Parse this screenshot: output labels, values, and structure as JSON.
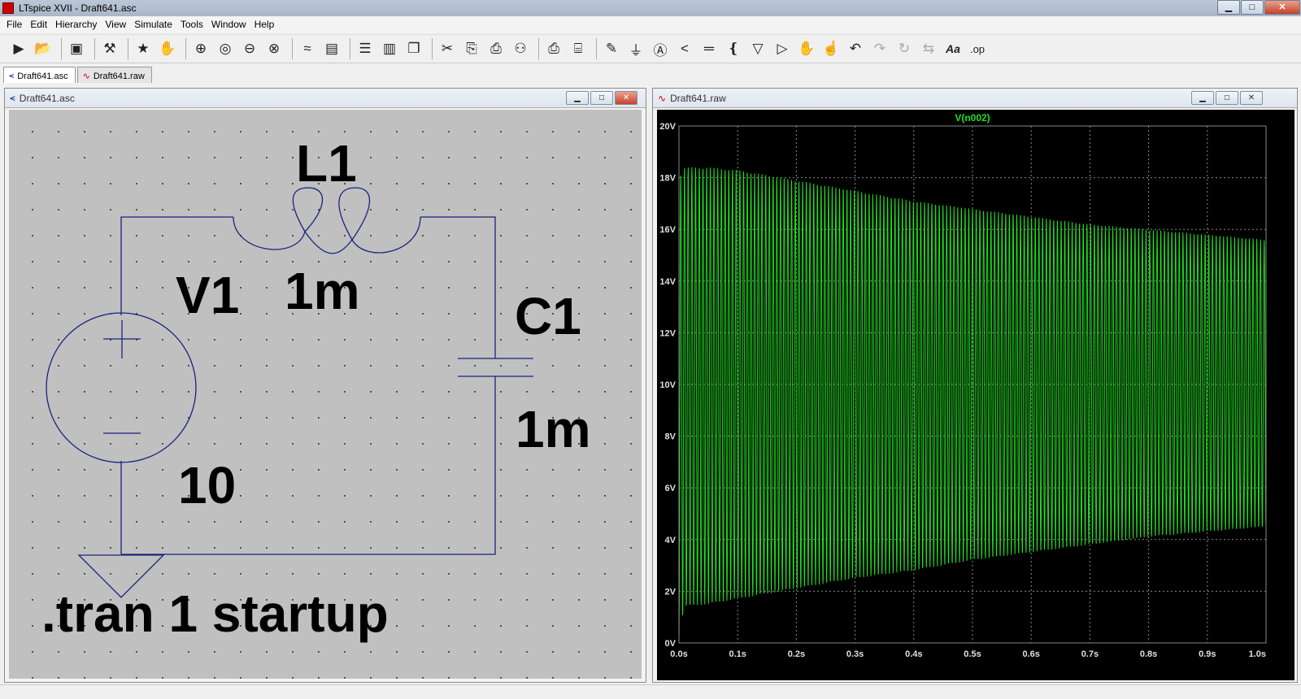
{
  "window": {
    "title": "LTspice XVII - Draft641.asc"
  },
  "menu": [
    "File",
    "Edit",
    "Hierarchy",
    "View",
    "Simulate",
    "Tools",
    "Window",
    "Help"
  ],
  "toolbar": {
    "icons": [
      "run-icon",
      "open-icon",
      "save-icon",
      "control-panel-icon",
      "run-man-icon",
      "pan-hand-icon",
      "zoom-in-icon",
      "zoom-to-fit-icon",
      "zoom-out-icon",
      "zoom-cancel-icon",
      "autorange-icon",
      "plot-settings-icon",
      "tile-horizontal-icon",
      "tile-vertical-icon",
      "cascade-icon",
      "cut-icon",
      "copy-icon",
      "paste-icon",
      "find-icon",
      "print-icon",
      "print-setup-icon",
      "pencil-wire-icon",
      "ground-icon",
      "label-net-icon",
      "resistor-icon",
      "capacitor-icon",
      "inductor-icon",
      "diode-icon",
      "component-icon",
      "move-icon",
      "drag-icon",
      "undo-icon",
      "redo-icon",
      "rotate-icon",
      "mirror-icon",
      "text-icon",
      "spice-directive-icon"
    ],
    "text_buttons": {
      "text": "Aa",
      "op": ".op"
    }
  },
  "tabs": [
    {
      "label": "Draft641.asc"
    },
    {
      "label": "Draft641.raw"
    }
  ],
  "schematic": {
    "title": "Draft641.asc",
    "labels": {
      "l1_name": "L1",
      "l1_value": "1m",
      "v1_name": "V1",
      "v1_value": "10",
      "c1_name": "C1",
      "c1_value": "1m",
      "directive": ".tran 1 startup"
    },
    "colors": {
      "wire": "#1a237e",
      "background": "#c0c0c0",
      "text": "#000000"
    }
  },
  "waveform": {
    "title": "Draft641.raw",
    "trace_label": "V(n002)",
    "colors": {
      "trace": "#22dd22",
      "background": "#000000",
      "grid": "#888888",
      "axis_text": "#e0e0e0"
    }
  },
  "chart_data": {
    "type": "line",
    "title": "V(n002)",
    "xlabel": "",
    "ylabel": "",
    "xlim": [
      0,
      1.0
    ],
    "ylim": [
      0,
      20
    ],
    "x_ticks": [
      "0.0s",
      "0.1s",
      "0.2s",
      "0.3s",
      "0.4s",
      "0.5s",
      "0.6s",
      "0.7s",
      "0.8s",
      "0.9s",
      "1.0s"
    ],
    "y_ticks": [
      "0V",
      "2V",
      "4V",
      "6V",
      "8V",
      "10V",
      "12V",
      "14V",
      "16V",
      "18V",
      "20V"
    ],
    "grid": true,
    "series": [
      {
        "name": "V(n002)",
        "oscillation_frequency_hz": 159,
        "envelope_time_s": [
          0.0,
          0.01,
          0.05,
          0.1,
          0.2,
          0.3,
          0.4,
          0.5,
          0.6,
          0.7,
          0.8,
          0.9,
          1.0
        ],
        "envelope_upper_v": [
          18.0,
          18.4,
          18.4,
          18.3,
          17.9,
          17.5,
          17.1,
          16.8,
          16.5,
          16.2,
          16.0,
          15.8,
          15.6
        ],
        "envelope_lower_v": [
          0.5,
          1.4,
          1.5,
          1.7,
          2.1,
          2.5,
          2.8,
          3.2,
          3.5,
          3.8,
          4.1,
          4.3,
          4.5
        ]
      }
    ]
  }
}
